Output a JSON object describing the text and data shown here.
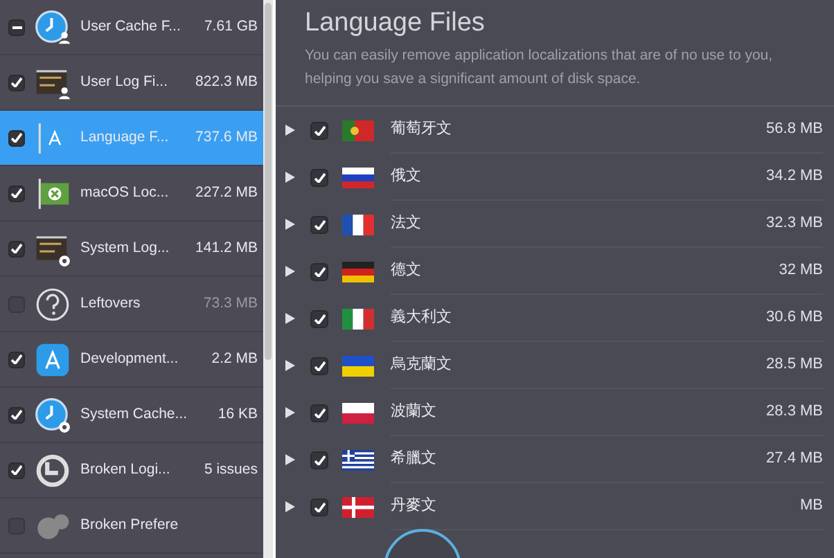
{
  "sidebar": {
    "items": [
      {
        "name": "User Cache F...",
        "size": "7.61 GB",
        "checked": true,
        "mixed": true,
        "selected": false
      },
      {
        "name": "User Log Fi...",
        "size": "822.3 MB",
        "checked": true,
        "mixed": false,
        "selected": false
      },
      {
        "name": "Language F...",
        "size": "737.6 MB",
        "checked": true,
        "mixed": false,
        "selected": true
      },
      {
        "name": "macOS Loc...",
        "size": "227.2 MB",
        "checked": true,
        "mixed": false,
        "selected": false
      },
      {
        "name": "System Log...",
        "size": "141.2 MB",
        "checked": true,
        "mixed": false,
        "selected": false
      },
      {
        "name": "Leftovers",
        "size": "73.3 MB",
        "checked": false,
        "mixed": false,
        "selected": false
      },
      {
        "name": "Development...",
        "size": "2.2 MB",
        "checked": true,
        "mixed": false,
        "selected": false
      },
      {
        "name": "System Cache...",
        "size": "16 KB",
        "checked": true,
        "mixed": false,
        "selected": false
      },
      {
        "name": "Broken Logi...",
        "size": "5 issues",
        "checked": true,
        "mixed": false,
        "selected": false
      },
      {
        "name": "Broken Prefere",
        "checked": false,
        "mixed": false,
        "selected": false
      }
    ]
  },
  "main": {
    "title": "Language Files",
    "description": "You can easily remove application localizations that are of no use to you, helping you save a significant amount of disk space.",
    "languages": [
      {
        "name": "葡萄牙文",
        "size": "56.8 MB",
        "checked": true,
        "expanded": false
      },
      {
        "name": "俄文",
        "size": "34.2 MB",
        "checked": true,
        "expanded": false
      },
      {
        "name": "法文",
        "size": "32.3 MB",
        "checked": true,
        "expanded": false
      },
      {
        "name": "德文",
        "size": "32 MB",
        "checked": true,
        "expanded": false
      },
      {
        "name": "義大利文",
        "size": "30.6 MB",
        "checked": true,
        "expanded": false
      },
      {
        "name": "烏克蘭文",
        "size": "28.5 MB",
        "checked": true,
        "expanded": false
      },
      {
        "name": "波蘭文",
        "size": "28.3 MB",
        "checked": true,
        "expanded": false
      },
      {
        "name": "希臘文",
        "size": "27.4 MB",
        "checked": true,
        "expanded": false
      },
      {
        "name": "丹麥文",
        "size": "MB",
        "checked": true,
        "expanded": false
      }
    ]
  }
}
